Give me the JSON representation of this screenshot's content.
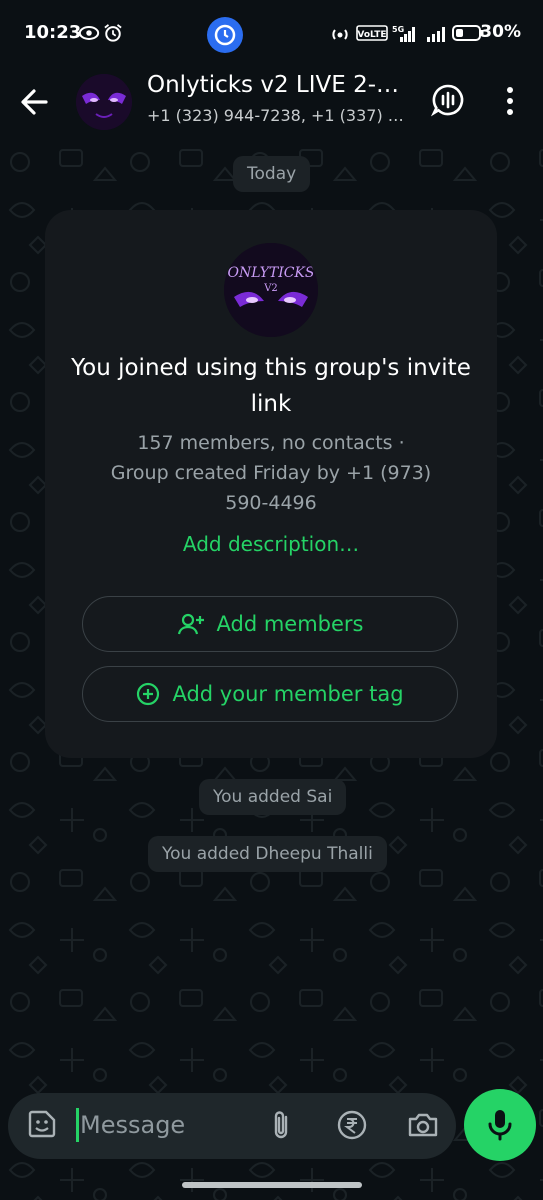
{
  "status_bar": {
    "time": "10:23",
    "battery": "30%",
    "icons": [
      "eye-icon",
      "alarm-icon",
      "hotspot-icon",
      "volte-icon",
      "5g-signal-icon",
      "signal-icon",
      "battery-icon"
    ]
  },
  "header": {
    "title": "Onlyticks v2 LIVE 2-…",
    "subtitle": "+1 (323) 944-7238, +1 (337) 2…"
  },
  "chat": {
    "date_chip": "Today",
    "info_card": {
      "avatar_text": "ONLYTICKS",
      "avatar_sub": "V2",
      "title": "You joined using this group's invite link",
      "meta_line1": "157 members, no contacts ·",
      "meta_line2": "Group created Friday by +1 (973)",
      "meta_line3": "590-4496",
      "add_description": "Add description…",
      "add_members": "Add members",
      "add_member_tag": "Add your member tag"
    },
    "system_messages": [
      "You added Sai",
      "You added Dheepu Thalli"
    ]
  },
  "composer": {
    "placeholder": "Message"
  },
  "colors": {
    "background": "#0b1014",
    "card": "#15191d",
    "accent": "#25d366",
    "chip": "#1c2226"
  }
}
